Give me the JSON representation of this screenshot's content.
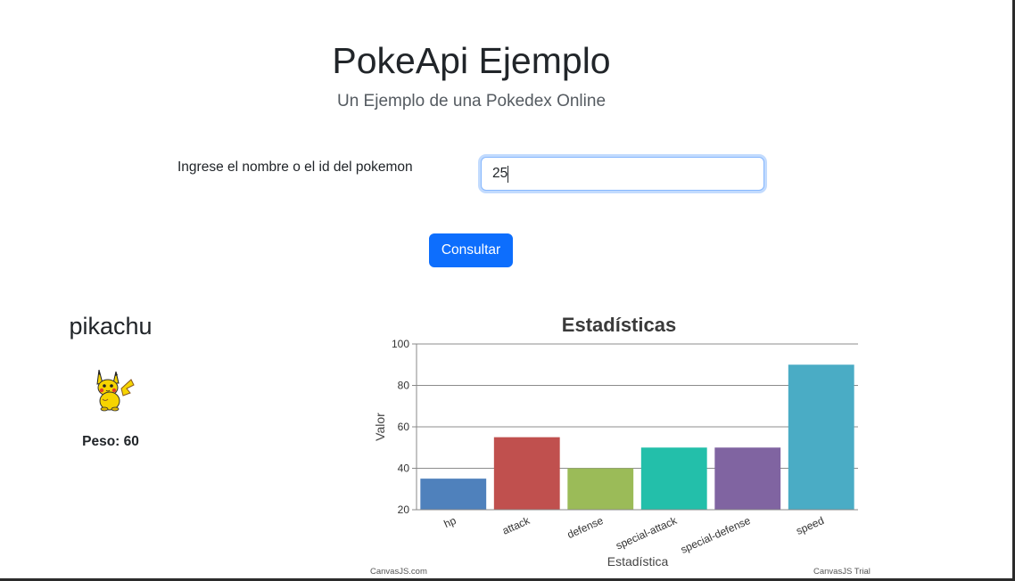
{
  "header": {
    "title": "PokeApi Ejemplo",
    "subtitle": "Un Ejemplo de una Pokedex Online"
  },
  "form": {
    "label": "Ingrese el nombre o el id del pokemon",
    "input_value": "25",
    "button_label": "Consultar"
  },
  "pokemon": {
    "name": "pikachu",
    "weight_text": "Peso: 60",
    "sprite": "pikachu-sprite"
  },
  "colors": {
    "primary": "#0d6efd",
    "focus_border": "#86b7fe"
  },
  "credits": {
    "left": "CanvasJS.com",
    "right": "CanvasJS Trial"
  },
  "chart_data": {
    "type": "bar",
    "title": "Estadísticas",
    "xlabel": "Estadística",
    "ylabel": "Valor",
    "categories": [
      "hp",
      "attack",
      "defense",
      "special-attack",
      "special-defense",
      "speed"
    ],
    "values": [
      35,
      55,
      40,
      50,
      50,
      90
    ],
    "colors": [
      "#4f81bc",
      "#c0504e",
      "#9bbb58",
      "#23bfaa",
      "#8064a1",
      "#4aacc5"
    ],
    "ylim": [
      20,
      100
    ],
    "yticks": [
      20,
      40,
      60,
      80,
      100
    ],
    "grid": true,
    "legend": "none"
  }
}
